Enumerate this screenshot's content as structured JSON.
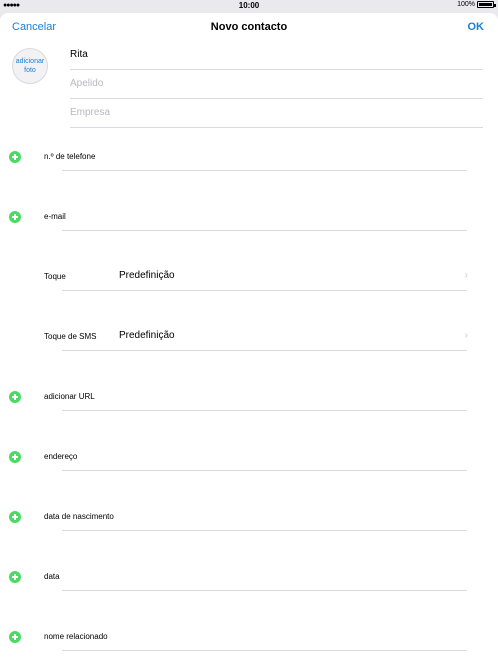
{
  "status_bar": {
    "signal": "●●●●●",
    "time": "10:00",
    "battery": "100%"
  },
  "nav": {
    "cancel_label": "Cancelar",
    "title": "Novo contacto",
    "ok_label": "OK"
  },
  "photo": {
    "line1": "adicionar",
    "line2": "foto"
  },
  "name_fields": {
    "first_name": "Rita",
    "last_name_placeholder": "Apelido",
    "company_placeholder": "Empresa"
  },
  "rows": {
    "phone": "n.º de telefone",
    "email": "e-mail",
    "ringtone_label": "Toque",
    "ringtone_value": "Predefinição",
    "sms_label": "Toque de SMS",
    "sms_value": "Predefinição",
    "url": "adicionar URL",
    "address": "endereço",
    "birthday": "data de nascimento",
    "date": "data",
    "related_name": "nome relacionado"
  },
  "colors": {
    "accent": "#1a7fd4",
    "add_green": "#4cd964",
    "separator": "#d9d9de",
    "placeholder": "#b8b8bf"
  }
}
